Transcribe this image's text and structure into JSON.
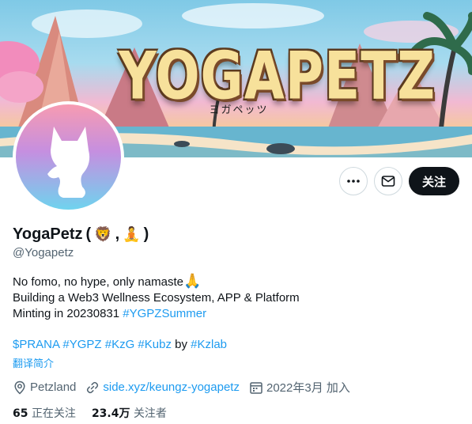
{
  "banner": {
    "title": "YOGAPETZ",
    "subtitle": "ヨガペッツ"
  },
  "profile": {
    "display_name": "YogaPetz",
    "name_suffix_open": "(",
    "name_emoji_lion": "🦁",
    "name_comma": ",",
    "name_emoji_yoga": "🧘",
    "name_suffix_close": ")",
    "handle": "@Yogapetz"
  },
  "actions": {
    "more_icon": "more-horizontal-icon",
    "message_icon": "envelope-icon",
    "follow_label": "关注"
  },
  "bio": {
    "line1_text": "No fomo, no hype, only namaste",
    "line1_emoji": "🙏",
    "line2": "Building a Web3 Wellness Ecosystem, APP & Platform",
    "line3_text": "Minting in 20230831 ",
    "line3_hashtag": "#YGPZSummer",
    "tags": [
      "$PRANA",
      "#YGPZ",
      "#KzG",
      "#Kubz"
    ],
    "by_text": "by",
    "by_tag": "#Kzlab",
    "translate_label": "翻译简介"
  },
  "meta": {
    "location": "Petzland",
    "website": "side.xyz/keungz-yogapetz",
    "joined": "2022年3月 加入"
  },
  "stats": {
    "following_count": "65",
    "following_label": "正在关注",
    "followers_count": "23.4万",
    "followers_label": "关注者"
  },
  "colors": {
    "link": "#1d9bf0",
    "text_primary": "#0f1419",
    "text_secondary": "#536471",
    "follow_button_bg": "#0f1419"
  }
}
